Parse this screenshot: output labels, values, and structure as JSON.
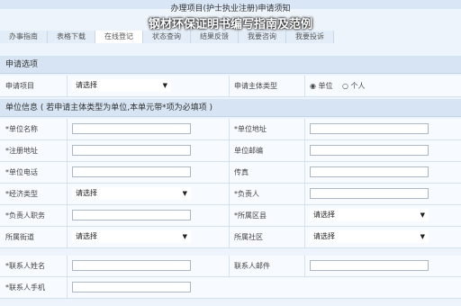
{
  "header": {
    "title": "办理项目(护士执业注册)申请须知"
  },
  "banner": "钢材环保证明书编写指南及范例",
  "tabs": [
    "办事指南",
    "表格下载",
    "在线登记",
    "状态查询",
    "结果反馈",
    "我要咨询",
    "我要投诉"
  ],
  "sections": {
    "apply": "申请选项",
    "unit": "单位信息 ( 若申请主体类型为单位,本单元带*项为必填项 )"
  },
  "apply_row": {
    "item_label": "申请项目",
    "item_value": "请选择",
    "type_label": "申请主体类型",
    "type_options": [
      "单位",
      "个人"
    ]
  },
  "unit_rows": {
    "r1": {
      "l": "*单位名称",
      "r": "*单位地址"
    },
    "r2": {
      "l": "*注册地址",
      "r": "单位邮编"
    },
    "r3": {
      "l": "*单位电话",
      "r": "传真"
    },
    "r4": {
      "l": "*经济类型",
      "lv": "请选择",
      "r": "*负责人"
    },
    "r5": {
      "l": "*负责人职务",
      "r": "*所属区县",
      "rv": "请选择"
    },
    "r6": {
      "l": "所属街道",
      "lv": "请选择",
      "r": "所属社区",
      "rv": "请选择"
    },
    "r7": {
      "l": "*联系人姓名",
      "r": "联系人邮件"
    },
    "r8": {
      "l": "*联系人手机"
    }
  }
}
